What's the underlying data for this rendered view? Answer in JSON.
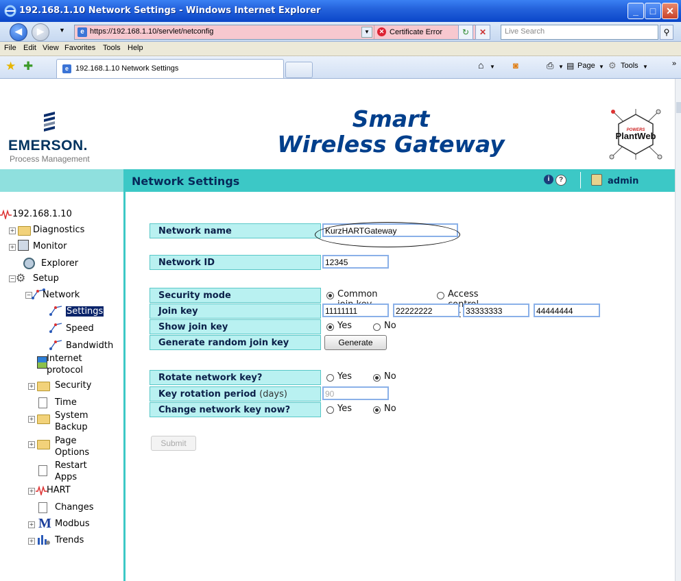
{
  "window": {
    "title": "192.168.1.10 Network Settings - Windows Internet Explorer"
  },
  "addressbar": {
    "url": "https://192.168.1.10/servlet/netconfig",
    "cert_error": "Certificate Error",
    "search_placeholder": "Live Search"
  },
  "menu": [
    "File",
    "Edit",
    "View",
    "Favorites",
    "Tools",
    "Help"
  ],
  "tab": {
    "title": "192.168.1.10 Network Settings"
  },
  "toolbar": {
    "page_label": "Page",
    "tools_label": "Tools"
  },
  "banner": {
    "company": "EMERSON.",
    "company_sub": "Process Management",
    "title_line1": "Smart",
    "title_line2": "Wireless Gateway",
    "plantweb_top": "POWERS",
    "plantweb_name": "PlantWeb"
  },
  "header": {
    "page_title": "Network Settings",
    "user": "admin"
  },
  "tree": {
    "root": "192.168.1.10",
    "items": [
      "Diagnostics",
      "Monitor",
      "Explorer",
      "Setup",
      "Network",
      "Settings",
      "Speed",
      "Bandwidth",
      "Internet",
      "protocol",
      "Security",
      "Time",
      "System",
      "Backup",
      "Page",
      "Options",
      "Restart",
      "Apps",
      "HART",
      "Changes",
      "Modbus",
      "Trends"
    ]
  },
  "form": {
    "network_name_label": "Network name",
    "network_name_value": "KurzHARTGateway",
    "network_id_label": "Network ID",
    "network_id_value": "12345",
    "security_mode_label": "Security mode",
    "security_mode_options": [
      "Common join key",
      "Access control list"
    ],
    "security_mode_selected": "Common join key",
    "join_key_label": "Join key",
    "join_key_values": [
      "11111111",
      "22222222",
      "33333333",
      "44444444"
    ],
    "show_join_key_label": "Show join key",
    "yes": "Yes",
    "no": "No",
    "show_join_key_selected": "Yes",
    "generate_label": "Generate random join key",
    "generate_button": "Generate",
    "rotate_label": "Rotate network key?",
    "rotate_selected": "No",
    "rotation_period_label": "Key rotation period",
    "rotation_period_unit": "(days)",
    "rotation_period_value": "90",
    "change_now_label": "Change network key now?",
    "change_now_selected": "No",
    "submit_button": "Submit"
  },
  "colors": {
    "teal_bar": "#3cc8c6",
    "label_bg": "#b9f1f1",
    "title_blue": "#003f8c",
    "ie_titlebar": "#2563dc"
  }
}
